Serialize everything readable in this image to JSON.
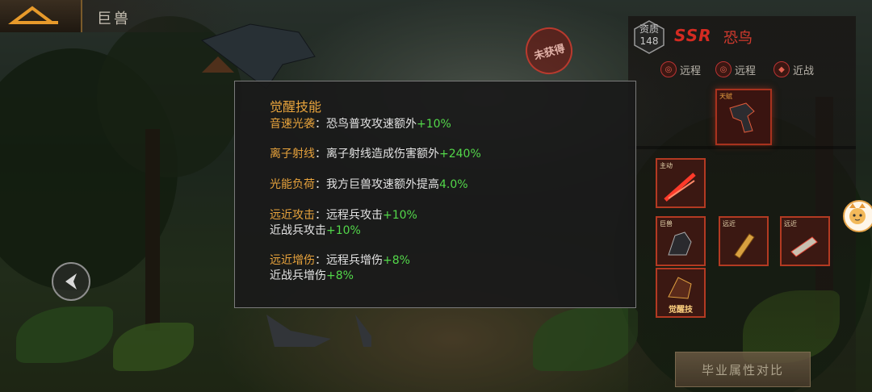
{
  "header": {
    "title": "巨兽"
  },
  "badge": {
    "not_obtained": "未获得"
  },
  "unit": {
    "quality_label": "资质",
    "quality_value": "148",
    "rarity": "SSR",
    "name": "恐鸟",
    "tags": [
      {
        "label": "远程",
        "icon": "ranged-icon"
      },
      {
        "label": "远程",
        "icon": "ranged-icon"
      },
      {
        "label": "近战",
        "icon": "melee-icon"
      }
    ],
    "portrait_label": "天赋"
  },
  "skills": {
    "active_label": "主动",
    "slot2_label": "巨兽",
    "slot3_label": "远近",
    "slot4_label": "远近",
    "awaken_label": "觉醒技"
  },
  "compare_button": "毕业属性对比",
  "dialog": {
    "title": "觉醒技能",
    "entries": [
      {
        "name": "音速光袭",
        "sep": "：",
        "text": "恐鸟普攻攻速额外",
        "value": "+10%"
      },
      {
        "name": "离子射线",
        "sep": "：",
        "text": "离子射线造成伤害额外",
        "value": "+240%"
      },
      {
        "name": "光能负荷",
        "sep": "：",
        "text": "我方巨兽攻速额外提高",
        "value": "4.0%"
      },
      {
        "name": "远近攻击",
        "sep": "：",
        "text": "远程兵攻击",
        "value": "+10%",
        "text2": "近战兵攻击",
        "value2": "+10%"
      },
      {
        "name": "远近增伤",
        "sep": "：",
        "text": "远程兵增伤",
        "value": "+8%",
        "text2": "近战兵增伤",
        "value2": "+8%"
      }
    ]
  },
  "colors": {
    "accent_orange": "#e8a33c",
    "bonus_green": "#53d84a",
    "ssr_red": "#d42b22"
  }
}
